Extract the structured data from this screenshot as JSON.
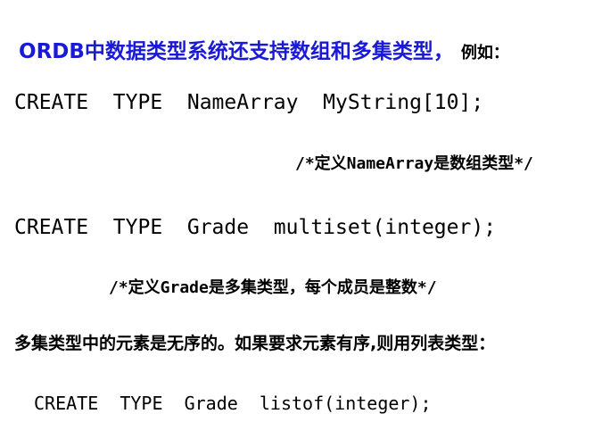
{
  "title": {
    "main": "ORDB中数据类型系统还支持数组和多集类型，",
    "suffix": "例如："
  },
  "code_lines": [
    "CREATE  TYPE  NameArray  MyString[10];",
    "CREATE  TYPE  Grade  multiset(integer);",
    "CREATE  TYPE  Grade  listof(integer);"
  ],
  "comments": [
    "/*定义NameArray是数组类型*/",
    "/*定义Grade是多集类型，每个成员是整数*/"
  ],
  "explanation": "多集类型中的元素是无序的。如果要求元素有序,则用列表类型：",
  "colors": {
    "title": "#1a1ad6",
    "text": "#000000",
    "background": "#ffffff"
  }
}
